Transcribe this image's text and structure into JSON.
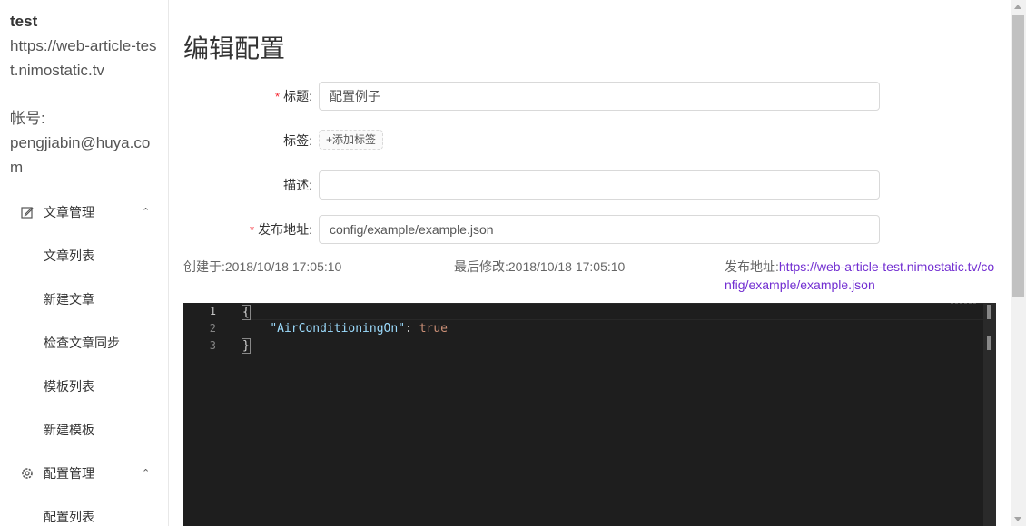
{
  "profile": {
    "name": "test",
    "site": "https://web-article-test.nimostatic.tv",
    "account_label": "帐号:",
    "account": "pengjiabin@huya.com"
  },
  "menu": {
    "groups": [
      {
        "label": "文章管理",
        "icon": "edit-icon",
        "items": [
          "文章列表",
          "新建文章",
          "检查文章同步",
          "模板列表",
          "新建模板"
        ]
      },
      {
        "label": "配置管理",
        "icon": "gear-icon",
        "items": [
          "配置列表"
        ]
      }
    ]
  },
  "page": {
    "title": "编辑配置",
    "fields": {
      "title_label": "标题:",
      "title_value": "配置例子",
      "tags_label": "标签:",
      "add_tag": "+添加标签",
      "desc_label": "描述:",
      "desc_value": "",
      "publish_label": "发布地址:",
      "publish_value": "config/example/example.json"
    },
    "meta": {
      "created_label": "创建于:",
      "created": "2018/10/18 17:05:10",
      "modified_label": "最后修改:",
      "modified": "2018/10/18 17:05:10",
      "url_label": "发布地址:",
      "url": "https://web-article-test.nimostatic.tv/config/example/example.json"
    }
  },
  "editor": {
    "line_numbers": [
      "1",
      "2",
      "3"
    ],
    "lines": {
      "open": "{",
      "key": "\"AirConditioningOn\"",
      "colon": ": ",
      "value": "true",
      "close": "}"
    }
  },
  "colors": {
    "required": "#f5222d",
    "link": "#722ed1",
    "editor_bg": "#1e1e1e"
  }
}
